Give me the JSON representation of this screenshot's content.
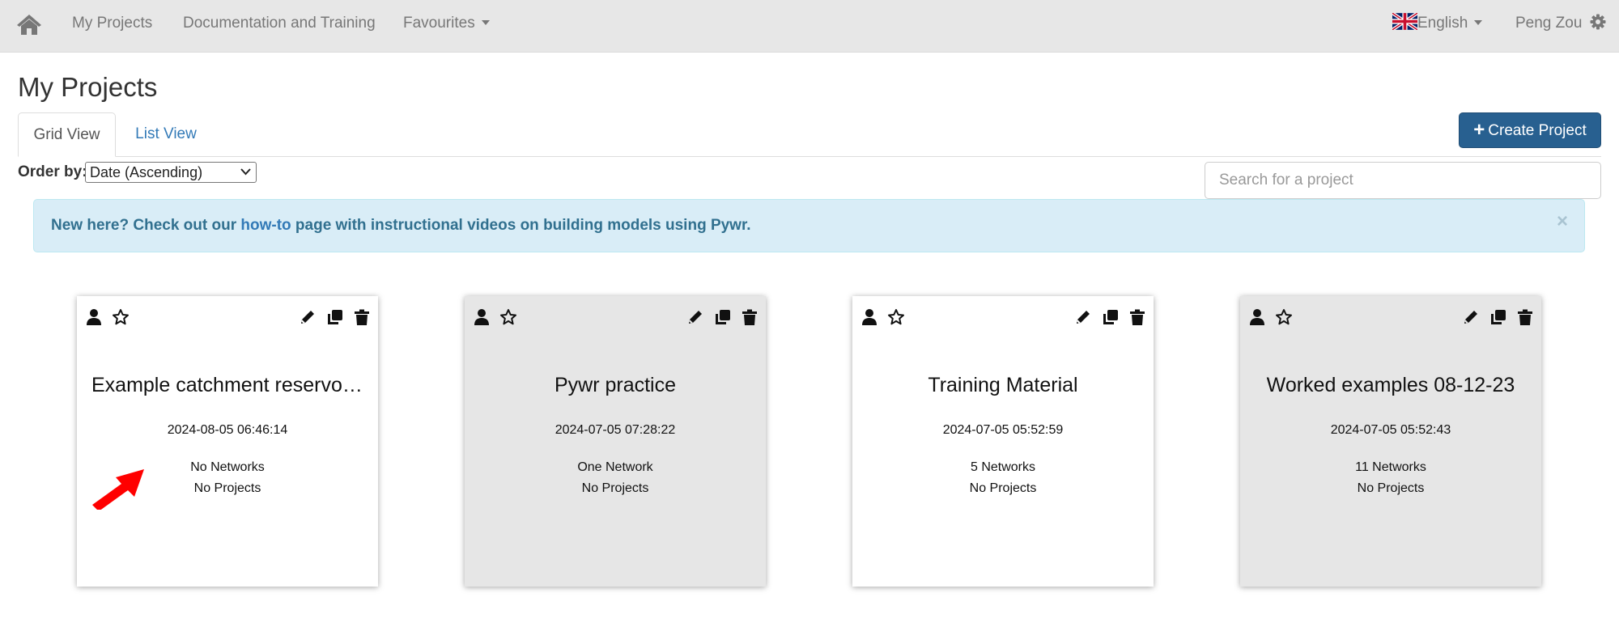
{
  "navbar": {
    "home_icon": "home-icon",
    "items": [
      {
        "label": "My Projects"
      },
      {
        "label": "Documentation and Training"
      },
      {
        "label": "Favourites"
      }
    ],
    "language": "English",
    "user": "Peng Zou"
  },
  "page": {
    "title": "My Projects",
    "tabs": [
      {
        "label": "Grid View",
        "active": true
      },
      {
        "label": "List View",
        "active": false
      }
    ],
    "create_button": "Create Project",
    "order_label": "Order by:",
    "order_value": "Date (Ascending)",
    "search_placeholder": "Search for a project"
  },
  "alert": {
    "text_before": "New here? Check out our ",
    "link": "how-to",
    "text_after": " page with instructional videos on building models using Pywr.",
    "close": "×"
  },
  "projects": [
    {
      "title": "Example catchment reservoir network",
      "date": "2024-08-05 06:46:14",
      "networks": "No Networks",
      "projects": "No Projects"
    },
    {
      "title": "Pywr practice",
      "date": "2024-07-05 07:28:22",
      "networks": "One Network",
      "projects": "No Projects"
    },
    {
      "title": "Training Material",
      "date": "2024-07-05 05:52:59",
      "networks": "5 Networks",
      "projects": "No Projects"
    },
    {
      "title": "Worked examples 08-12-23",
      "date": "2024-07-05 05:52:43",
      "networks": "11 Networks",
      "projects": "No Projects"
    }
  ],
  "colors": {
    "navbar_bg": "#e7e7e7",
    "primary_button": "#286090",
    "alert_bg": "#d9edf7",
    "arrow": "#ff0000"
  }
}
